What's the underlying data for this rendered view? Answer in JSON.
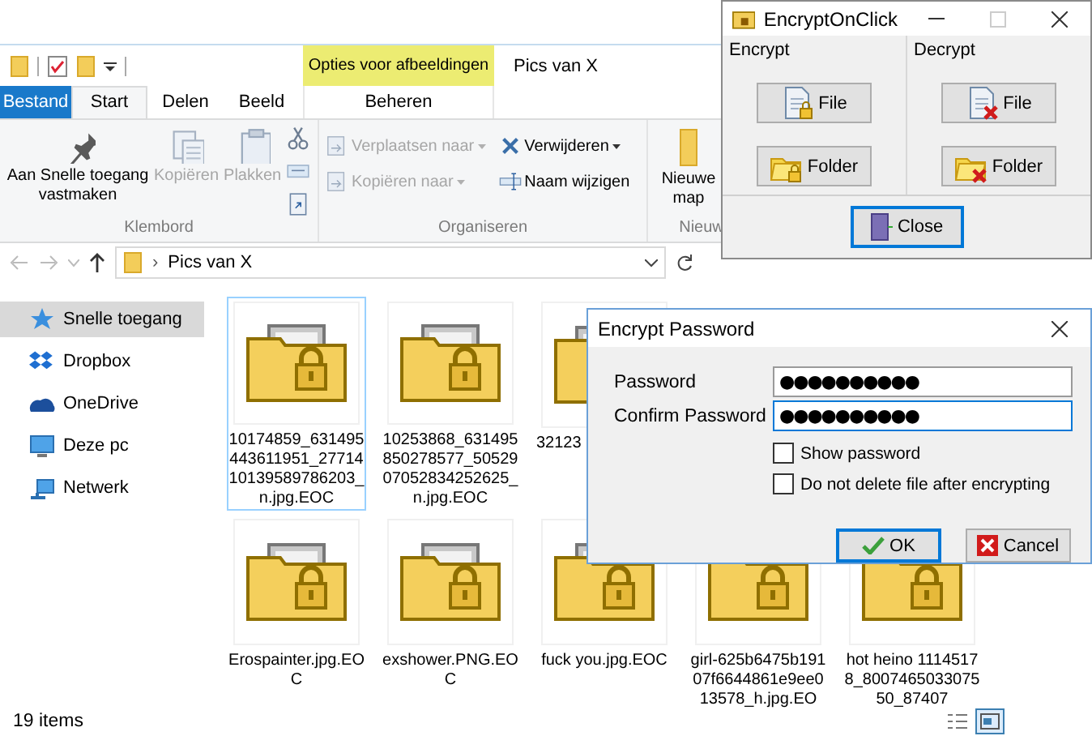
{
  "explorer": {
    "context_group": "Opties voor afbeeldingen",
    "title": "Pics van X",
    "tabs": [
      {
        "label": "Bestand",
        "kind": "file",
        "selected": false
      },
      {
        "label": "Start",
        "kind": "normal",
        "selected": true
      },
      {
        "label": "Delen",
        "kind": "normal",
        "selected": false
      },
      {
        "label": "Beeld",
        "kind": "normal",
        "selected": false
      },
      {
        "label": "Beheren",
        "kind": "contextual",
        "selected": false
      }
    ],
    "ribbon": {
      "clipboard": {
        "label": "Klembord",
        "pin": {
          "label": "Aan Snelle toegang vastmaken",
          "disabled": false
        },
        "copy": {
          "label": "Kopiëren",
          "disabled": true
        },
        "paste": {
          "label": "Plakken",
          "disabled": true
        }
      },
      "organize": {
        "label": "Organiseren",
        "move_to": {
          "label": "Verplaatsen naar",
          "disabled": true
        },
        "copy_to": {
          "label": "Kopiëren naar",
          "disabled": true
        },
        "delete": {
          "label": "Verwijderen",
          "disabled": false
        },
        "rename": {
          "label": "Naam wijzigen",
          "disabled": false
        }
      },
      "new": {
        "label": "Nieuw",
        "new_folder": {
          "label": "Nieuwe map",
          "disabled": false
        }
      }
    },
    "address": {
      "separator": "›",
      "path": "Pics van X"
    },
    "sidebar": {
      "items": [
        {
          "label": "Snelle toegang",
          "selected": true
        },
        {
          "label": "Dropbox",
          "selected": false
        },
        {
          "label": "OneDrive",
          "selected": false
        },
        {
          "label": "Deze pc",
          "selected": false
        },
        {
          "label": "Netwerk",
          "selected": false
        }
      ]
    },
    "file_rows": [
      [
        {
          "name": "10174859_631495443611951_2771410139589786203_n.jpg.EOC",
          "kind": "full",
          "selected": true
        },
        {
          "name": "10253868_631495850278577_5052907052834252625_n.jpg.EOC",
          "kind": "full",
          "selected": false
        },
        {
          "name": "32123",
          "kind": "partial",
          "selected": false
        }
      ],
      [
        {
          "name": "Erospainter.jpg.EOC",
          "kind": "full",
          "selected": false
        },
        {
          "name": "exshower.PNG.EOC",
          "kind": "full",
          "selected": false
        },
        {
          "name": "fuck you.jpg.EOC",
          "kind": "full",
          "selected": false
        },
        {
          "name": "girl-625b6475b19107f6644861e9ee013578_h.jpg.EO",
          "kind": "full",
          "selected": false
        },
        {
          "name": "hot heino 11145178_800746503307550_87407",
          "kind": "full",
          "selected": false
        }
      ]
    ],
    "status_bar": {
      "count": "19 items",
      "views": [
        {
          "selected": false
        },
        {
          "selected": true
        }
      ]
    }
  },
  "encrypt_on_click": {
    "title": "EncryptOnClick",
    "groups": [
      {
        "label": "Encrypt",
        "kind": "encrypt",
        "buttons": [
          "File",
          "Folder"
        ]
      },
      {
        "label": "Decrypt",
        "kind": "decrypt",
        "buttons": [
          "File",
          "Folder"
        ]
      }
    ],
    "close": "Close"
  },
  "password_dialog": {
    "title": "Encrypt Password",
    "fields": [
      {
        "label": "Password",
        "value": "●●●●●●●●●●",
        "focused": false
      },
      {
        "label": "Confirm Password",
        "value": "●●●●●●●●●●",
        "focused": true
      }
    ],
    "checkboxes": [
      {
        "label": "Show password",
        "checked": false
      },
      {
        "label": "Do not delete file after encrypting",
        "checked": false
      }
    ],
    "buttons": [
      {
        "label": "OK",
        "kind": "ok",
        "default": true
      },
      {
        "label": "Cancel",
        "kind": "cancel",
        "default": false
      }
    ]
  }
}
